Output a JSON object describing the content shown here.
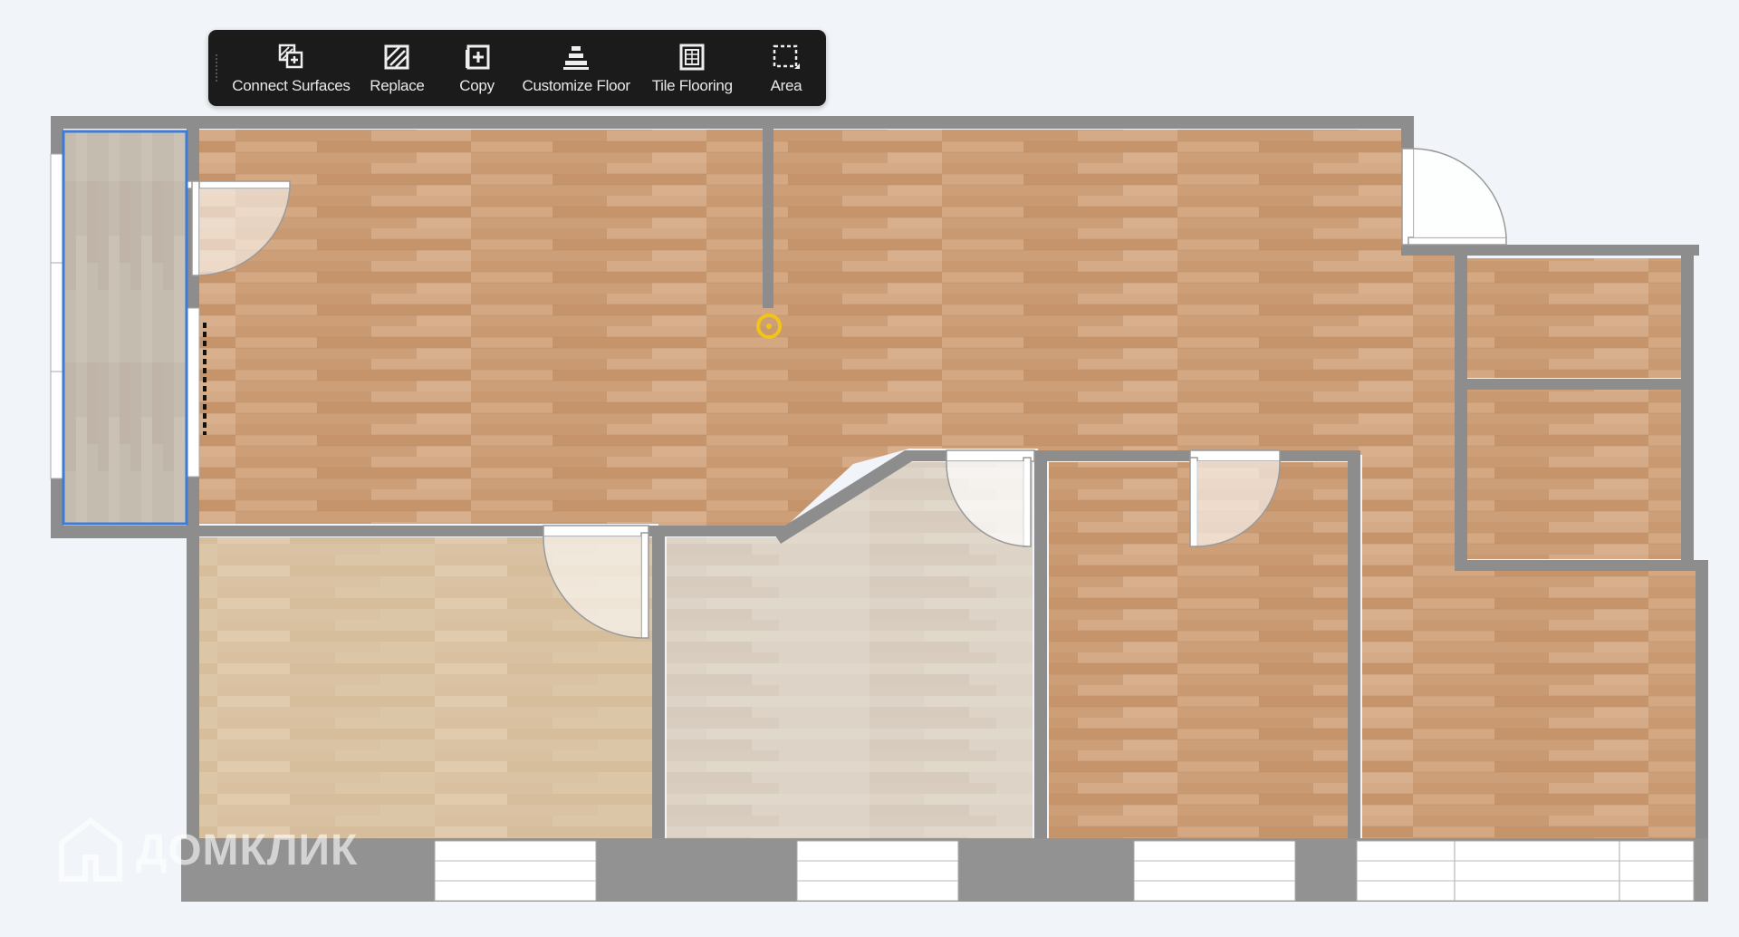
{
  "toolbar": {
    "items": [
      {
        "label": "Connect Surfaces",
        "icon": "connect-surfaces-icon"
      },
      {
        "label": "Replace",
        "icon": "replace-icon"
      },
      {
        "label": "Copy",
        "icon": "copy-icon"
      },
      {
        "label": "Customize Floor",
        "icon": "customize-floor-icon"
      },
      {
        "label": "Tile Flooring",
        "icon": "tile-flooring-icon"
      },
      {
        "label": "Area",
        "icon": "area-icon"
      }
    ]
  },
  "watermark": {
    "text": "ДОМКЛИК"
  },
  "colors": {
    "wall": "#8d8d8d",
    "floor_oak": "#cfa27c",
    "floor_light_oak": "#dcc6a8",
    "floor_whitewash": "#ddd3c6",
    "floor_gray_oak": "#c5bcb0",
    "selection": "#3d7bd9",
    "snap_point": "#f0c419",
    "background": "#f1f4f8",
    "toolbar_bg": "#1b1b1b"
  }
}
